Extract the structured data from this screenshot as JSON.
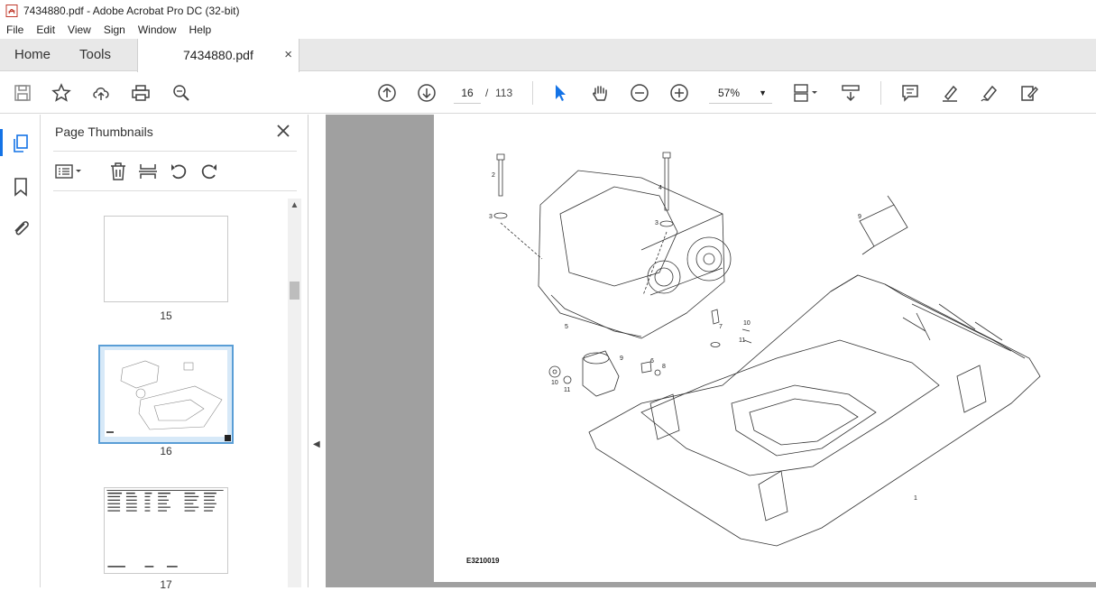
{
  "window": {
    "title": "7434880.pdf - Adobe Acrobat Pro DC (32-bit)"
  },
  "menu": [
    "File",
    "Edit",
    "View",
    "Sign",
    "Window",
    "Help"
  ],
  "tabs": {
    "home": "Home",
    "tools": "Tools",
    "document": "7434880.pdf",
    "close": "×"
  },
  "toolbar": {
    "current_page": "16",
    "page_separator": "/",
    "total_pages": "113",
    "zoom": "57%",
    "icons": [
      "save-icon",
      "star-icon",
      "upload-icon",
      "print-icon",
      "zoom-search-icon",
      "page-up-icon",
      "page-down-icon",
      "select-cursor-icon",
      "hand-icon",
      "zoom-out-icon",
      "zoom-in-icon",
      "page-fit-icon",
      "scroll-mode-icon",
      "comment-icon",
      "highlight-icon",
      "sign-icon",
      "edit-pdf-icon"
    ]
  },
  "side_panel": {
    "title": "Page Thumbnails",
    "thumbnails": [
      {
        "label": "15"
      },
      {
        "label": "16",
        "selected": true
      },
      {
        "label": "17"
      }
    ]
  },
  "document": {
    "drawing_code": "E3210019",
    "callouts": [
      "1",
      "2",
      "3",
      "3",
      "4",
      "5",
      "6",
      "7",
      "8",
      "9",
      "9",
      "10",
      "10",
      "11",
      "11"
    ]
  },
  "colors": {
    "accent": "#1473e6",
    "selection": "#5a9ed6",
    "viewer_bg": "#a0a0a0"
  }
}
